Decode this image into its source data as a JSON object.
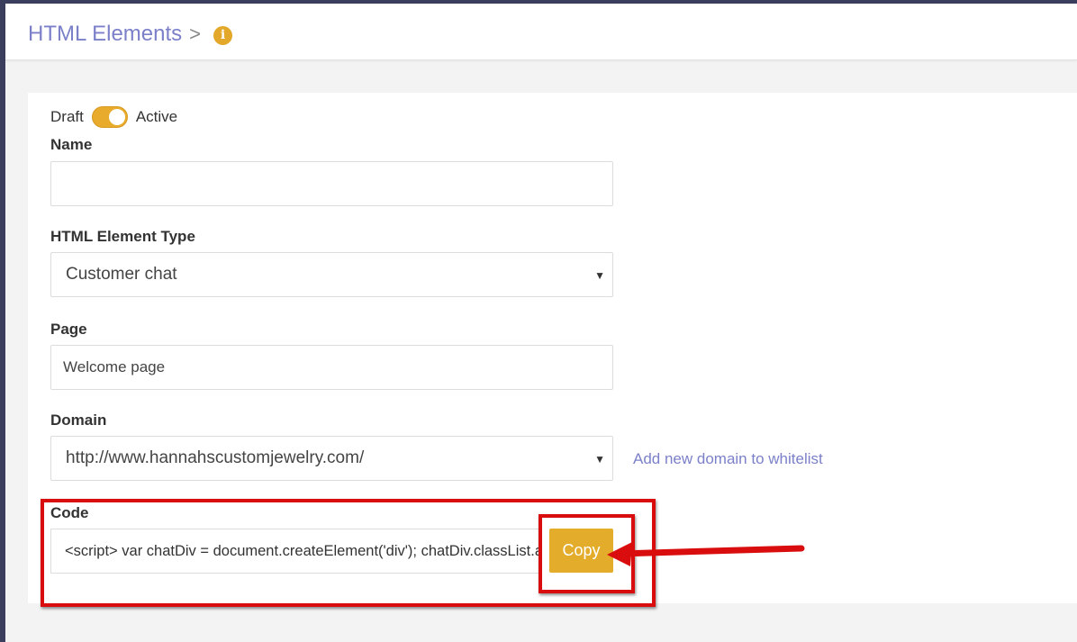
{
  "header": {
    "title": "HTML Elements",
    "separator": ">",
    "info_icon": "info-icon"
  },
  "form": {
    "status": {
      "draft_label": "Draft",
      "active_label": "Active",
      "is_active": true
    },
    "name": {
      "label": "Name",
      "value": ""
    },
    "element_type": {
      "label": "HTML Element Type",
      "selected": "Customer chat"
    },
    "page": {
      "label": "Page",
      "value": "Welcome page"
    },
    "domain": {
      "label": "Domain",
      "selected": "http://www.hannahscustomjewelry.com/",
      "add_link": "Add new domain to whitelist"
    },
    "code": {
      "label": "Code",
      "value": "<script> var chatDiv = document.createElement('div'); chatDiv.classList.add('chat');",
      "copy_label": "Copy"
    }
  },
  "colors": {
    "accent": "#e3ac2a",
    "link": "#7b80c9",
    "annotation": "#d90d0d"
  }
}
